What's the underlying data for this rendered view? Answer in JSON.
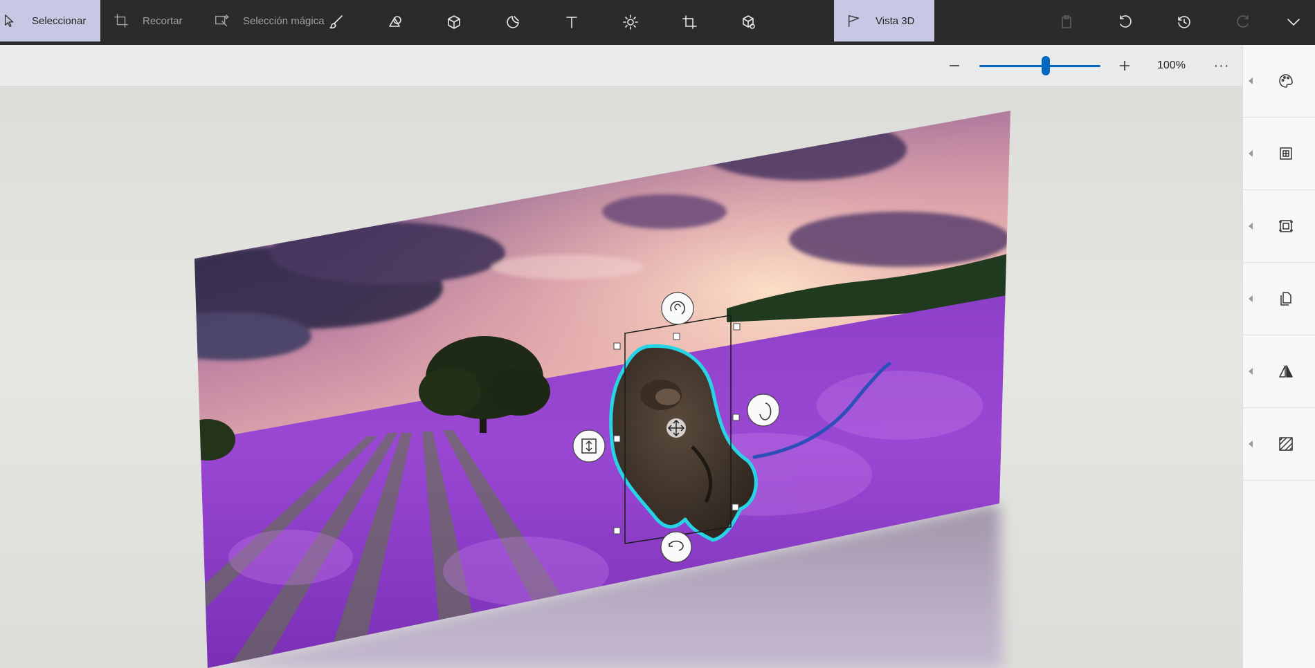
{
  "topbar": {
    "tools": [
      {
        "name": "folder-menu-icon"
      },
      {
        "name": "brush-icon"
      },
      {
        "name": "2d-shapes-icon"
      },
      {
        "name": "3d-shapes-icon"
      },
      {
        "name": "stickers-icon"
      },
      {
        "name": "text-icon"
      },
      {
        "name": "effects-icon"
      },
      {
        "name": "canvas-icon"
      },
      {
        "name": "3d-library-icon"
      },
      {
        "name": "paste-icon",
        "disabled": true
      },
      {
        "name": "undo-icon"
      },
      {
        "name": "history-icon"
      },
      {
        "name": "redo-icon",
        "disabled": true
      },
      {
        "name": "expand-chevron-icon"
      }
    ]
  },
  "subbar": {
    "select_label": "Seleccionar",
    "crop_label": "Recortar",
    "magic_select_label": "Selección mágica",
    "view3d_label": "Vista 3D",
    "zoom_percent": "100%",
    "zoom_slider_value": 0.55,
    "more_label": "···"
  },
  "right_panel": {
    "items": [
      {
        "name": "color-palette-icon"
      },
      {
        "name": "rotate-flip-icon"
      },
      {
        "name": "object-position-icon"
      },
      {
        "name": "copy-paste-icon"
      },
      {
        "name": "mirror-icon"
      },
      {
        "name": "texture-icon"
      }
    ]
  },
  "colors": {
    "topbar_bg": "#2b2b2b",
    "subbar_bg": "#eaeaeb",
    "selected_bg": "#c7c9e4",
    "accent": "#0067c0",
    "selection_outline": "#27d4e6"
  }
}
